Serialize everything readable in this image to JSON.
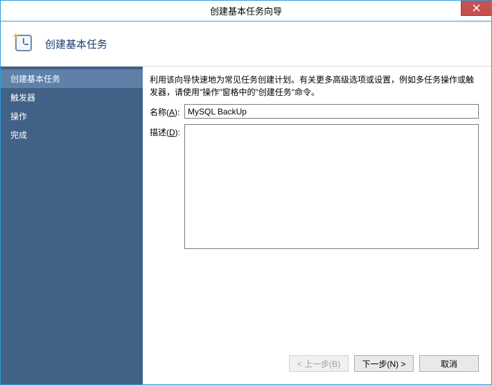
{
  "window": {
    "title": "创建基本任务向导"
  },
  "header": {
    "title": "创建基本任务"
  },
  "sidebar": {
    "items": [
      {
        "label": "创建基本任务",
        "active": true
      },
      {
        "label": "触发器",
        "active": false
      },
      {
        "label": "操作",
        "active": false
      },
      {
        "label": "完成",
        "active": false
      }
    ]
  },
  "content": {
    "intro": "利用该向导快速地为常见任务创建计划。有关更多高级选项或设置，例如多任务操作或触发器，请使用\"操作\"窗格中的\"创建任务\"命令。",
    "name_label_prefix": "名称(",
    "name_label_key": "A",
    "name_label_suffix": "):",
    "name_value": "MySQL BackUp",
    "desc_label_prefix": "描述(",
    "desc_label_key": "D",
    "desc_label_suffix": "):",
    "desc_value": ""
  },
  "footer": {
    "back": "< 上一步(B)",
    "next": "下一步(N) >",
    "cancel": "取消"
  }
}
